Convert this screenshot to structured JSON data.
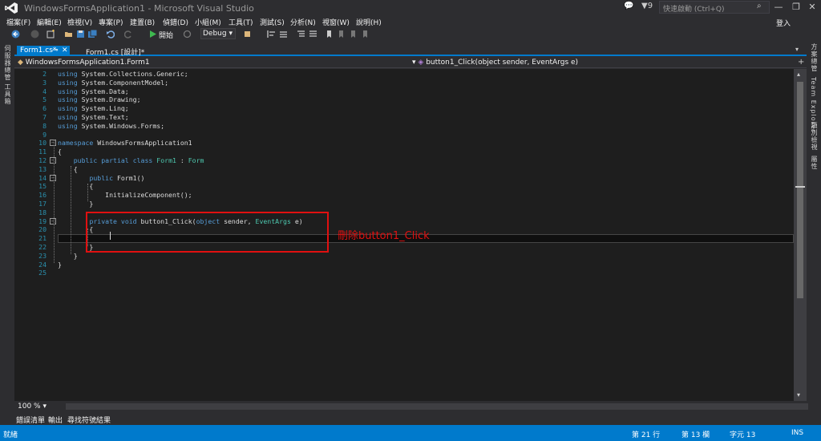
{
  "title": "WindowsFormsApplication1 - Microsoft Visual Studio",
  "notifications": "9",
  "quick_launch_placeholder": "快速啟動 (Ctrl+Q)",
  "sign_in": "登入",
  "menu": [
    "檔案(F)",
    "編輯(E)",
    "檢視(V)",
    "專案(P)",
    "建置(B)",
    "偵錯(D)",
    "小組(M)",
    "工具(T)",
    "測試(S)",
    "分析(N)",
    "視窗(W)",
    "說明(H)"
  ],
  "toolbar": {
    "start_label": "開始",
    "config": "Debug"
  },
  "left_tabs": [
    "伺服器總管",
    "工具箱"
  ],
  "right_tabs": [
    "方案總管",
    "Team Explorer",
    "類別檢視",
    "屬性"
  ],
  "tabs": {
    "active": "Form1.cs*",
    "inactive": "Form1.cs [設計]*"
  },
  "nav": {
    "left": "WindowsFormsApplication1.Form1",
    "right": "button1_Click(object sender, EventArgs e)"
  },
  "code_lines": [
    {
      "n": "2",
      "tokens": [
        [
          "kw",
          "using"
        ],
        [
          "tx",
          " System.Collections.Generic;"
        ]
      ]
    },
    {
      "n": "3",
      "tokens": [
        [
          "kw",
          "using"
        ],
        [
          "tx",
          " System.ComponentModel;"
        ]
      ]
    },
    {
      "n": "4",
      "tokens": [
        [
          "kw",
          "using"
        ],
        [
          "tx",
          " System.Data;"
        ]
      ]
    },
    {
      "n": "5",
      "tokens": [
        [
          "kw",
          "using"
        ],
        [
          "tx",
          " System.Drawing;"
        ]
      ]
    },
    {
      "n": "6",
      "tokens": [
        [
          "kw",
          "using"
        ],
        [
          "tx",
          " System.Linq;"
        ]
      ]
    },
    {
      "n": "7",
      "tokens": [
        [
          "kw",
          "using"
        ],
        [
          "tx",
          " System.Text;"
        ]
      ]
    },
    {
      "n": "8",
      "tokens": [
        [
          "kw",
          "using"
        ],
        [
          "tx",
          " System.Windows.Forms;"
        ]
      ]
    },
    {
      "n": "9",
      "tokens": []
    },
    {
      "n": "10",
      "tokens": [
        [
          "kw",
          "namespace"
        ],
        [
          "tx",
          " WindowsFormsApplication1"
        ]
      ]
    },
    {
      "n": "11",
      "tokens": [
        [
          "tx",
          "{"
        ]
      ]
    },
    {
      "n": "12",
      "tokens": [
        [
          "tx",
          "    "
        ],
        [
          "kw",
          "public"
        ],
        [
          "tx",
          " "
        ],
        [
          "kw",
          "partial"
        ],
        [
          "tx",
          " "
        ],
        [
          "kw",
          "class"
        ],
        [
          "tx",
          " "
        ],
        [
          "ty",
          "Form1"
        ],
        [
          "tx",
          " : "
        ],
        [
          "ty",
          "Form"
        ]
      ]
    },
    {
      "n": "13",
      "tokens": [
        [
          "tx",
          "    {"
        ]
      ]
    },
    {
      "n": "14",
      "tokens": [
        [
          "tx",
          "        "
        ],
        [
          "kw",
          "public"
        ],
        [
          "tx",
          " Form1()"
        ]
      ]
    },
    {
      "n": "15",
      "tokens": [
        [
          "tx",
          "        {"
        ]
      ]
    },
    {
      "n": "16",
      "tokens": [
        [
          "tx",
          "            InitializeComponent();"
        ]
      ]
    },
    {
      "n": "17",
      "tokens": [
        [
          "tx",
          "        }"
        ]
      ]
    },
    {
      "n": "18",
      "tokens": []
    },
    {
      "n": "19",
      "tokens": [
        [
          "tx",
          "        "
        ],
        [
          "kw",
          "private"
        ],
        [
          "tx",
          " "
        ],
        [
          "kw",
          "void"
        ],
        [
          "tx",
          " button1_Click("
        ],
        [
          "kw",
          "object"
        ],
        [
          "tx",
          " sender, "
        ],
        [
          "ty",
          "EventArgs"
        ],
        [
          "tx",
          " e)"
        ]
      ]
    },
    {
      "n": "20",
      "tokens": [
        [
          "tx",
          "        {"
        ]
      ]
    },
    {
      "n": "21",
      "tokens": []
    },
    {
      "n": "22",
      "tokens": [
        [
          "tx",
          "        }"
        ]
      ]
    },
    {
      "n": "23",
      "tokens": [
        [
          "tx",
          "    }"
        ]
      ]
    },
    {
      "n": "24",
      "tokens": [
        [
          "tx",
          "}"
        ]
      ]
    },
    {
      "n": "25",
      "tokens": []
    }
  ],
  "annotation": "刪除button1_Click",
  "zoom": "100 %",
  "bottom_tabs": [
    "錯誤清單",
    "輸出",
    "尋找符號結果"
  ],
  "status": {
    "ready": "就緒",
    "line": "第 21 行",
    "col": "第 13 欄",
    "char": "字元 13",
    "ins": "INS"
  },
  "colors": {
    "accent": "#007acc",
    "keyword": "#569cd6",
    "type": "#4ec9b0",
    "annotation": "#e01010"
  }
}
